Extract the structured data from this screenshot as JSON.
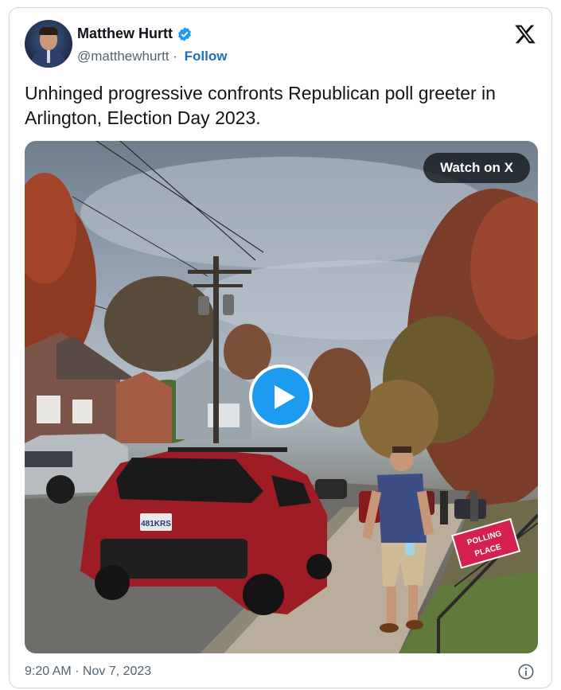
{
  "author": {
    "name": "Matthew Hurtt",
    "handle": "@matthewhurtt",
    "separator": " · ",
    "follow_label": "Follow",
    "verified_color": "#1d9bf0"
  },
  "brand": {
    "icon": "x-logo-icon"
  },
  "tweet": {
    "text": "Unhinged progressive confronts Republican poll greeter in Arlington, Election Day 2023."
  },
  "media": {
    "watch_label": "Watch on X",
    "license_plate": "481KRS",
    "sign_line1": "POLLING",
    "sign_line2": "PLACE",
    "play_color": "#1d9bf0"
  },
  "footer": {
    "timestamp": "9:20 AM · Nov 7, 2023",
    "info_icon": "info-icon"
  }
}
